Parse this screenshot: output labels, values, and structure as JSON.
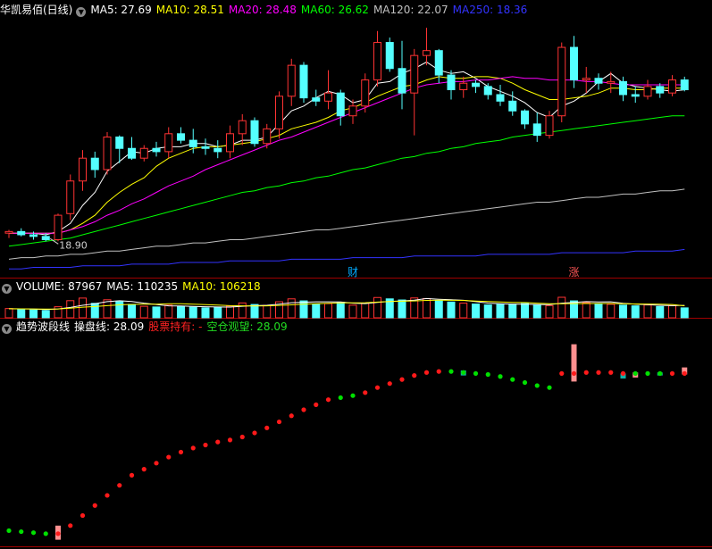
{
  "panels": {
    "price": {
      "title": "华凯易佰(日线)",
      "ma_legend": [
        {
          "label": "MA5: 27.69",
          "color": "#ffffff"
        },
        {
          "label": "MA10: 28.51",
          "color": "#ffff00"
        },
        {
          "label": "MA20: 28.48",
          "color": "#ff00ff"
        },
        {
          "label": "MA60: 26.62",
          "color": "#00ff00"
        },
        {
          "label": "MA120: 22.07",
          "color": "#c0c0c0"
        },
        {
          "label": "MA250: 18.36",
          "color": "#3333ff"
        }
      ],
      "low_label": "18.90",
      "markers": [
        "财",
        "涨"
      ]
    },
    "volume": {
      "legend": [
        {
          "label": "VOLUME: 87967",
          "color": "#ffffff"
        },
        {
          "label": "MA5: 110235",
          "color": "#ffffff"
        },
        {
          "label": "MA10: 106218",
          "color": "#ffff00"
        }
      ]
    },
    "indicator": {
      "legend": [
        {
          "label": "趋势波段线",
          "color": "#ffffff"
        },
        {
          "label": "操盘线: 28.09",
          "color": "#ffffff"
        },
        {
          "label": "股票持有: -",
          "color": "#ff2222"
        },
        {
          "label": "空仓观望: 28.09",
          "color": "#22dd22"
        }
      ]
    }
  },
  "colors": {
    "up": "#ff3333",
    "down": "#54ffff",
    "divider": "#a00000",
    "hold_dot": "#ff1a1a",
    "empty_dot": "#00e000",
    "spike": "#ff9090"
  },
  "chart_data": [
    {
      "type": "candlestick",
      "title": "华凯易佰(日线)",
      "candles_ohlc": [
        [
          19.4,
          19.6,
          19.1,
          19.5
        ],
        [
          19.5,
          19.7,
          19.2,
          19.3
        ],
        [
          19.3,
          19.5,
          19.0,
          19.2
        ],
        [
          19.2,
          19.4,
          18.9,
          19.0
        ],
        [
          19.0,
          20.6,
          18.9,
          20.5
        ],
        [
          20.6,
          23.0,
          20.2,
          22.6
        ],
        [
          22.6,
          24.5,
          22.0,
          24.0
        ],
        [
          24.0,
          24.4,
          22.8,
          23.3
        ],
        [
          23.3,
          25.6,
          23.0,
          25.3
        ],
        [
          25.3,
          25.4,
          23.7,
          24.6
        ],
        [
          24.6,
          25.3,
          23.9,
          24.0
        ],
        [
          24.0,
          24.8,
          23.8,
          24.6
        ],
        [
          24.6,
          25.0,
          24.1,
          24.4
        ],
        [
          24.4,
          25.9,
          24.0,
          25.5
        ],
        [
          25.5,
          25.9,
          24.9,
          25.1
        ],
        [
          25.1,
          25.8,
          24.3,
          24.7
        ],
        [
          24.7,
          25.2,
          24.2,
          24.6
        ],
        [
          24.6,
          25.1,
          24.0,
          24.4
        ],
        [
          24.4,
          26.0,
          24.0,
          25.5
        ],
        [
          25.5,
          26.7,
          24.8,
          26.3
        ],
        [
          26.3,
          26.5,
          24.7,
          24.9
        ],
        [
          24.9,
          26.1,
          24.6,
          25.8
        ],
        [
          25.8,
          28.1,
          25.2,
          27.8
        ],
        [
          27.8,
          30.1,
          27.2,
          29.7
        ],
        [
          29.7,
          29.9,
          27.4,
          27.7
        ],
        [
          27.7,
          28.2,
          27.2,
          27.5
        ],
        [
          27.5,
          29.4,
          27.0,
          28.0
        ],
        [
          28.0,
          28.2,
          26.0,
          26.6
        ],
        [
          26.6,
          27.6,
          26.1,
          27.2
        ],
        [
          27.2,
          29.2,
          26.8,
          28.8
        ],
        [
          28.8,
          31.8,
          28.4,
          31.1
        ],
        [
          31.1,
          31.4,
          29.3,
          29.5
        ],
        [
          29.5,
          31.2,
          27.0,
          28.0
        ],
        [
          28.0,
          30.7,
          25.4,
          30.3
        ],
        [
          30.3,
          32.0,
          29.7,
          30.6
        ],
        [
          30.6,
          30.7,
          28.6,
          29.1
        ],
        [
          29.1,
          29.4,
          27.6,
          28.2
        ],
        [
          28.2,
          29.0,
          27.7,
          28.6
        ],
        [
          28.6,
          28.8,
          28.0,
          28.4
        ],
        [
          28.4,
          28.6,
          27.6,
          27.9
        ],
        [
          27.9,
          28.5,
          27.2,
          27.5
        ],
        [
          27.5,
          28.1,
          26.6,
          26.9
        ],
        [
          26.9,
          27.0,
          25.8,
          26.1
        ],
        [
          26.1,
          26.8,
          25.0,
          25.4
        ],
        [
          25.4,
          26.9,
          25.2,
          26.6
        ],
        [
          26.6,
          31.1,
          26.2,
          30.8
        ],
        [
          30.8,
          31.5,
          28.3,
          28.8
        ],
        [
          28.8,
          29.6,
          28.0,
          28.9
        ],
        [
          28.9,
          29.2,
          28.2,
          28.6
        ],
        [
          28.6,
          29.3,
          28.0,
          28.7
        ],
        [
          28.7,
          29.0,
          27.5,
          27.9
        ],
        [
          27.9,
          28.4,
          27.4,
          27.8
        ],
        [
          27.8,
          28.8,
          27.6,
          28.4
        ],
        [
          28.4,
          28.6,
          27.7,
          28.0
        ],
        [
          28.0,
          29.1,
          27.8,
          28.8
        ],
        [
          28.8,
          29.0,
          28.1,
          28.2
        ]
      ],
      "moving_averages": [
        {
          "name": "MA5",
          "color": "#ffffff",
          "values": [
            19.4,
            19.4,
            19.4,
            19.3,
            19.5,
            20.0,
            21.1,
            21.9,
            23.2,
            23.8,
            24.4,
            24.3,
            24.6,
            24.7,
            24.7,
            24.9,
            24.9,
            24.7,
            24.8,
            25.1,
            25.1,
            25.3,
            26.1,
            26.9,
            27.2,
            27.7,
            28.1,
            27.9,
            27.4,
            27.6,
            28.6,
            28.7,
            29.2,
            29.5,
            29.9,
            29.4,
            29.2,
            29.3,
            28.9,
            28.4,
            28.1,
            27.8,
            27.4,
            26.8,
            26.5,
            27.2,
            27.5,
            28.0,
            28.7,
            29.2,
            28.6,
            28.4,
            28.3,
            28.2,
            28.1,
            28.2
          ]
        },
        {
          "name": "MA10",
          "color": "#ffff00",
          "values": [
            19.4,
            19.4,
            19.4,
            19.4,
            19.4,
            19.6,
            20.0,
            20.5,
            21.3,
            21.9,
            22.4,
            22.8,
            23.5,
            24.0,
            24.3,
            24.6,
            24.7,
            24.7,
            24.8,
            24.9,
            25.0,
            25.2,
            25.4,
            25.8,
            26.0,
            26.2,
            26.5,
            26.9,
            27.1,
            27.4,
            27.8,
            28.1,
            28.4,
            28.5,
            28.8,
            29.0,
            28.9,
            28.9,
            29.0,
            29.0,
            28.9,
            28.6,
            28.2,
            27.9,
            27.6,
            27.6,
            27.7,
            27.8,
            28.0,
            28.3,
            28.3,
            28.2,
            28.2,
            28.3,
            28.3,
            28.3
          ]
        },
        {
          "name": "MA20",
          "color": "#ff00ff",
          "values": [
            19.4,
            19.4,
            19.4,
            19.4,
            19.4,
            19.6,
            19.8,
            20.1,
            20.5,
            20.8,
            21.2,
            21.5,
            21.9,
            22.3,
            22.6,
            22.9,
            23.3,
            23.6,
            23.9,
            24.2,
            24.5,
            24.8,
            25.1,
            25.3,
            25.6,
            25.9,
            26.2,
            26.5,
            26.8,
            27.1,
            27.4,
            27.7,
            28.0,
            28.3,
            28.5,
            28.6,
            28.7,
            28.7,
            28.8,
            28.8,
            28.9,
            29.0,
            28.9,
            28.9,
            28.8,
            28.8,
            28.8,
            28.7,
            28.7,
            28.6,
            28.5,
            28.5,
            28.5,
            28.5,
            28.5,
            28.5
          ]
        },
        {
          "name": "MA60",
          "color": "#00ff00",
          "values": [
            18.6,
            18.7,
            18.8,
            18.9,
            19.0,
            19.1,
            19.3,
            19.5,
            19.7,
            19.9,
            20.1,
            20.3,
            20.5,
            20.7,
            20.9,
            21.1,
            21.3,
            21.5,
            21.7,
            21.9,
            22.0,
            22.2,
            22.3,
            22.5,
            22.6,
            22.8,
            22.9,
            23.1,
            23.3,
            23.4,
            23.6,
            23.8,
            24.0,
            24.1,
            24.3,
            24.4,
            24.6,
            24.7,
            24.9,
            25.0,
            25.1,
            25.3,
            25.4,
            25.5,
            25.6,
            25.7,
            25.8,
            25.9,
            26.0,
            26.1,
            26.2,
            26.3,
            26.4,
            26.5,
            26.6,
            26.6
          ]
        },
        {
          "name": "MA120",
          "color": "#c0c0c0",
          "values": [
            17.8,
            17.9,
            17.9,
            18.0,
            18.0,
            18.1,
            18.1,
            18.2,
            18.3,
            18.3,
            18.4,
            18.5,
            18.6,
            18.6,
            18.7,
            18.8,
            18.8,
            18.9,
            19.0,
            19.0,
            19.1,
            19.2,
            19.3,
            19.4,
            19.5,
            19.6,
            19.6,
            19.7,
            19.8,
            19.9,
            20.0,
            20.1,
            20.2,
            20.3,
            20.4,
            20.5,
            20.6,
            20.7,
            20.8,
            20.9,
            21.0,
            21.1,
            21.2,
            21.3,
            21.3,
            21.4,
            21.5,
            21.6,
            21.6,
            21.7,
            21.8,
            21.8,
            21.9,
            22.0,
            22.0,
            22.1
          ]
        },
        {
          "name": "MA250",
          "color": "#3333ff",
          "values": [
            17.2,
            17.2,
            17.3,
            17.3,
            17.3,
            17.3,
            17.4,
            17.4,
            17.4,
            17.4,
            17.5,
            17.5,
            17.5,
            17.5,
            17.6,
            17.6,
            17.6,
            17.6,
            17.7,
            17.7,
            17.7,
            17.7,
            17.7,
            17.8,
            17.8,
            17.8,
            17.8,
            17.8,
            17.9,
            17.9,
            17.9,
            17.9,
            17.9,
            18.0,
            18.0,
            18.0,
            18.0,
            18.0,
            18.0,
            18.1,
            18.1,
            18.1,
            18.1,
            18.1,
            18.1,
            18.2,
            18.2,
            18.2,
            18.2,
            18.2,
            18.2,
            18.3,
            18.3,
            18.3,
            18.3,
            18.4
          ]
        }
      ],
      "annotations": [
        {
          "text": "18.90",
          "bar_index": 3,
          "value": 18.9
        },
        {
          "text": "财",
          "bar_index": 28
        },
        {
          "text": "涨",
          "bar_index": 46
        }
      ],
      "ylim": [
        17.0,
        32.5
      ]
    },
    {
      "type": "bar",
      "title": "VOLUME",
      "values": [
        82000,
        76000,
        70000,
        64000,
        98000,
        152000,
        175000,
        128000,
        160000,
        142000,
        118000,
        102000,
        96000,
        112000,
        99000,
        94000,
        88000,
        91000,
        104000,
        132000,
        118000,
        110000,
        142000,
        168000,
        150000,
        122000,
        126000,
        138000,
        112000,
        130000,
        180000,
        168000,
        158000,
        176000,
        170000,
        150000,
        140000,
        130000,
        122000,
        114000,
        118000,
        120000,
        126000,
        112000,
        108000,
        182000,
        150000,
        134000,
        126000,
        120000,
        112000,
        106000,
        114000,
        100000,
        108000,
        87967
      ],
      "up_down": [
        1,
        0,
        0,
        0,
        1,
        1,
        1,
        0,
        1,
        0,
        0,
        1,
        0,
        1,
        0,
        0,
        0,
        0,
        1,
        1,
        0,
        1,
        1,
        1,
        0,
        0,
        1,
        0,
        1,
        1,
        1,
        0,
        0,
        1,
        1,
        0,
        0,
        1,
        0,
        0,
        0,
        0,
        0,
        0,
        1,
        1,
        0,
        1,
        0,
        1,
        0,
        0,
        1,
        0,
        1,
        0
      ],
      "ma5": [
        80000,
        79000,
        77000,
        74000,
        78000,
        92000,
        111000,
        124000,
        143000,
        151000,
        145000,
        130000,
        118000,
        106000,
        105000,
        101000,
        98000,
        96000,
        95000,
        102000,
        108000,
        111000,
        121000,
        134000,
        138000,
        142000,
        142000,
        141000,
        130000,
        126000,
        137000,
        146000,
        150000,
        157000,
        171000,
        165000,
        160000,
        155000,
        143000,
        131000,
        125000,
        121000,
        120000,
        118000,
        117000,
        130000,
        136000,
        143000,
        140000,
        142000,
        128000,
        120000,
        116000,
        111000,
        108000,
        110235
      ],
      "ma10": [
        80000,
        79000,
        78000,
        77000,
        78000,
        85000,
        94000,
        100000,
        108000,
        115000,
        119000,
        120000,
        121000,
        124000,
        124000,
        121000,
        116000,
        113000,
        108000,
        106000,
        105000,
        106000,
        110000,
        115000,
        120000,
        124000,
        128000,
        132000,
        133000,
        134000,
        139000,
        145000,
        147000,
        150000,
        154000,
        156000,
        155000,
        154000,
        149000,
        144000,
        141000,
        137000,
        135000,
        130000,
        124000,
        125000,
        126000,
        127000,
        127000,
        127000,
        124000,
        123000,
        122000,
        120000,
        118000,
        106218
      ]
    },
    {
      "type": "scatter",
      "title": "趋势波段线",
      "series": [
        {
          "name": "操盘线",
          "values": [
            19.3,
            19.25,
            19.2,
            19.15,
            19.15,
            19.55,
            20.05,
            20.55,
            21.05,
            21.55,
            22.05,
            22.35,
            22.65,
            22.95,
            23.2,
            23.4,
            23.55,
            23.7,
            23.8,
            23.95,
            24.15,
            24.4,
            24.7,
            25.0,
            25.3,
            25.55,
            25.8,
            25.9,
            26.0,
            26.15,
            26.4,
            26.6,
            26.8,
            27.0,
            27.15,
            27.2,
            27.2,
            27.15,
            27.1,
            27.05,
            26.95,
            26.8,
            26.65,
            26.5,
            26.4,
            27.1,
            27.1,
            27.15,
            27.15,
            27.15,
            27.1,
            27.1,
            27.1,
            27.1,
            27.1,
            27.1
          ]
        }
      ],
      "state_hold": [
        0,
        0,
        0,
        0,
        1,
        1,
        1,
        1,
        1,
        1,
        1,
        1,
        1,
        1,
        1,
        1,
        1,
        1,
        1,
        1,
        1,
        1,
        1,
        1,
        1,
        1,
        1,
        0,
        0,
        1,
        1,
        1,
        1,
        1,
        1,
        1,
        0,
        0,
        0,
        0,
        0,
        0,
        0,
        0,
        0,
        1,
        1,
        1,
        1,
        1,
        1,
        0,
        0,
        0,
        1,
        1
      ],
      "bars": [
        {
          "bar_index": 4,
          "from": 18.85,
          "to": 19.55,
          "kind": "hold"
        },
        {
          "bar_index": 37,
          "from": 27.0,
          "to": 27.25,
          "kind": "empty"
        },
        {
          "bar_index": 46,
          "from": 26.7,
          "to": 28.55,
          "kind": "hold"
        },
        {
          "bar_index": 50,
          "from": 26.85,
          "to": 27.1,
          "kind": "empty"
        },
        {
          "bar_index": 51,
          "from": 26.9,
          "to": 27.15,
          "kind": "hold"
        },
        {
          "bar_index": 53,
          "from": 27.0,
          "to": 27.15,
          "kind": "empty"
        },
        {
          "bar_index": 55,
          "from": 27.05,
          "to": 27.4,
          "kind": "hold"
        }
      ],
      "ylim": [
        18.7,
        28.8
      ]
    }
  ]
}
